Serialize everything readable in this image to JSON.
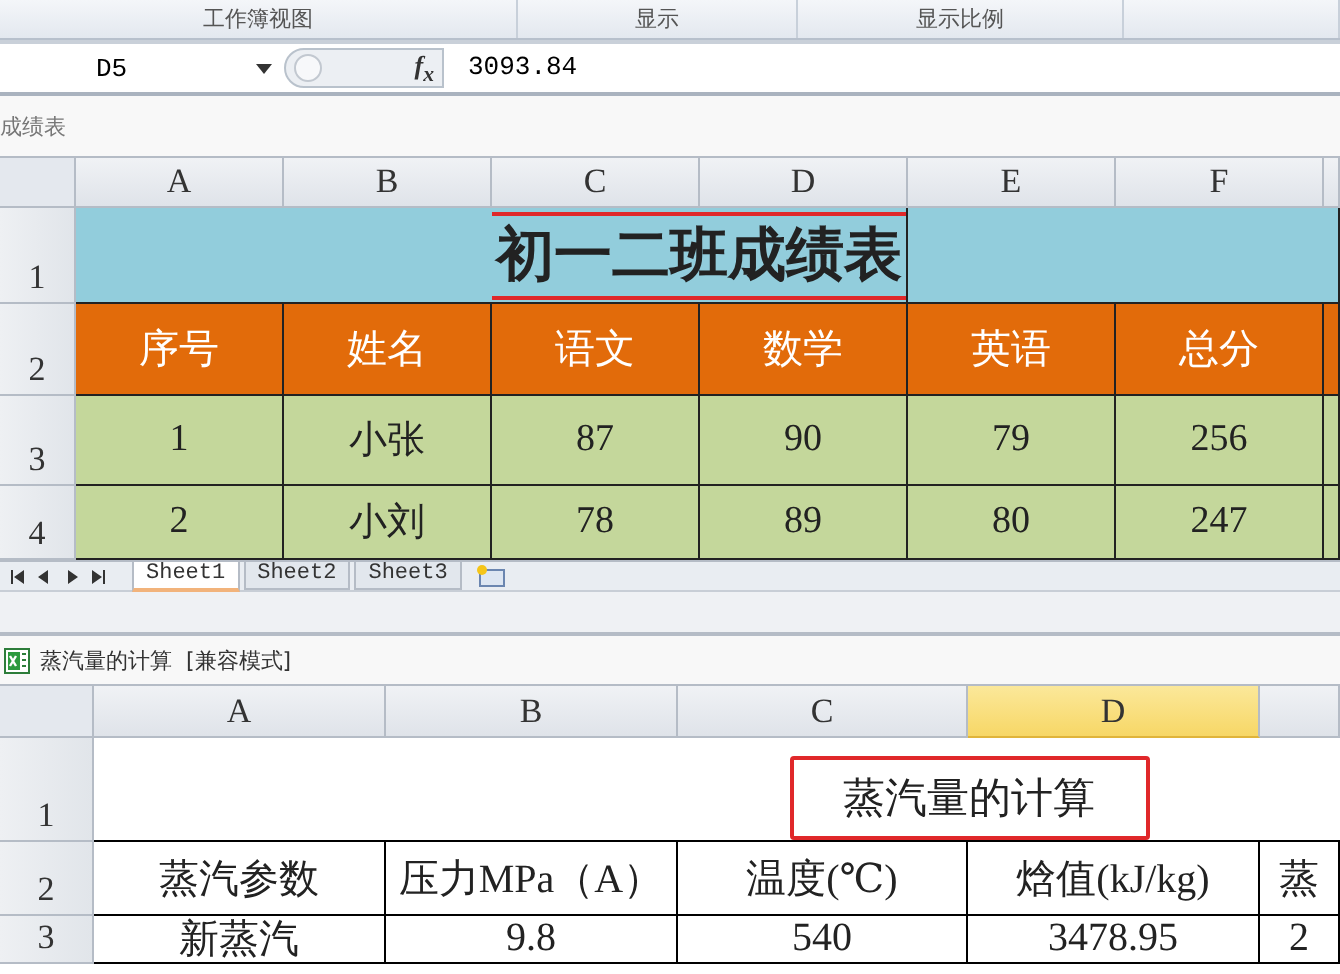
{
  "ribbon_groups": [
    "工作簿视图",
    "显示",
    "显示比例"
  ],
  "formula_bar": {
    "name_box": "D5",
    "fx_label": "f$_{x}$",
    "value": "3093.84"
  },
  "windows": [
    {
      "kind": "grades",
      "title": "成绩表",
      "columns": [
        {
          "label": "A",
          "selected": false
        },
        {
          "label": "B",
          "selected": false
        },
        {
          "label": "C",
          "selected": false
        },
        {
          "label": "D",
          "selected": false
        },
        {
          "label": "E",
          "selected": false
        },
        {
          "label": "F",
          "selected": false
        }
      ],
      "rows": [
        {
          "header": "1",
          "kind": "title",
          "cells": [
            {
              "text": ""
            },
            {
              "text": ""
            },
            {
              "text": "初一二班成绩表",
              "highlighted": true
            },
            {
              "text": ""
            },
            {
              "text": ""
            }
          ]
        },
        {
          "header": "2",
          "kind": "header",
          "cells": [
            {
              "text": "序号"
            },
            {
              "text": "姓名"
            },
            {
              "text": "语文"
            },
            {
              "text": "数学"
            },
            {
              "text": "英语"
            },
            {
              "text": "总分"
            }
          ]
        },
        {
          "header": "3",
          "kind": "data",
          "cells": [
            {
              "text": "1"
            },
            {
              "text": "小张"
            },
            {
              "text": "87"
            },
            {
              "text": "90"
            },
            {
              "text": "79"
            },
            {
              "text": "256"
            }
          ]
        },
        {
          "header": "4",
          "kind": "data",
          "cells": [
            {
              "text": "2"
            },
            {
              "text": "小刘"
            },
            {
              "text": "78"
            },
            {
              "text": "89"
            },
            {
              "text": "80"
            },
            {
              "text": "247"
            }
          ]
        }
      ],
      "sheet_tabs": [
        {
          "label": "Sheet1",
          "selected": true
        },
        {
          "label": "Sheet2",
          "selected": false
        },
        {
          "label": "Sheet3",
          "selected": false
        }
      ]
    },
    {
      "kind": "steam",
      "title": "蒸汽量的计算",
      "mode": "[兼容模式]",
      "columns": [
        {
          "label": "A",
          "selected": false
        },
        {
          "label": "B",
          "selected": false
        },
        {
          "label": "C",
          "selected": false
        },
        {
          "label": "D",
          "selected": true
        }
      ],
      "rows": [
        {
          "header": "1",
          "kind": "plain",
          "cells": [
            {
              "text": ""
            },
            {
              "text": ""
            },
            {
              "text": "蒸汽量的计算",
              "highlighted": true
            }
          ]
        },
        {
          "header": "2",
          "kind": "plain",
          "cells": [
            {
              "text": "蒸汽参数"
            },
            {
              "text": "压力MPa（A）"
            },
            {
              "text": "温度(℃)"
            },
            {
              "text": "焓值(kJ/kg)"
            },
            {
              "text": "蒸"
            }
          ]
        },
        {
          "header": "3",
          "kind": "plain",
          "cells": [
            {
              "text": "新蒸汽"
            },
            {
              "text": "9.8"
            },
            {
              "text": "540"
            },
            {
              "text": "3478.95"
            },
            {
              "text": "2"
            }
          ]
        }
      ]
    }
  ]
}
